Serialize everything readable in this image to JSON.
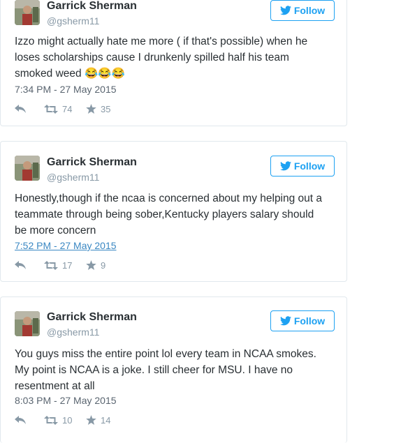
{
  "tweets": [
    {
      "name": "Garrick Sherman",
      "handle": "@gsherm11",
      "follow_label": "Follow",
      "lines": [
        "Izzo might actually hate me more ( if that's possible) when he",
        "loses scholarships cause I drunkenly spilled half his team",
        "smoked weed 😂😂😂"
      ],
      "timestamp": "7:34 PM - 27 May 2015",
      "retweets": "74",
      "favorites": "35"
    },
    {
      "name": "Garrick Sherman",
      "handle": "@gsherm11",
      "follow_label": "Follow",
      "lines": [
        "Honestly,though if the ncaa is concerned about my helping out a",
        "teammate through being sober,Kentucky players salary should",
        "be more concern"
      ],
      "timestamp": "7:52 PM - 27 May 2015",
      "retweets": "17",
      "favorites": "9"
    },
    {
      "name": "Garrick Sherman",
      "handle": "@gsherm11",
      "follow_label": "Follow",
      "lines": [
        "You guys miss the entire point lol every team in NCAA smokes.",
        "My point is NCAA is a joke. I still cheer for MSU. I have no",
        "resentment at all"
      ],
      "timestamp": "8:03 PM - 27 May 2015",
      "retweets": "10",
      "favorites": "14"
    }
  ],
  "colors": {
    "accent": "#1da1f2",
    "text": "#292f33",
    "muted": "#8899a6",
    "border": "#e1e8ed"
  },
  "icons": [
    "twitter-bird-icon",
    "reply-icon",
    "retweet-icon",
    "star-icon"
  ]
}
